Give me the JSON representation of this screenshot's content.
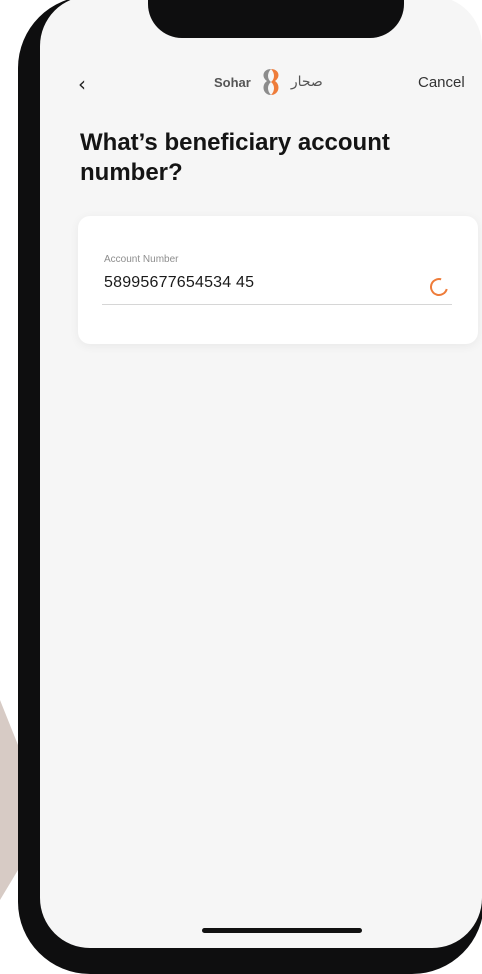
{
  "nav": {
    "back_icon": "‹",
    "logo_latin": "Sohar",
    "logo_arabic": "صحار",
    "cancel_label": "Cancel"
  },
  "page": {
    "title": "What’s beneficiary account number?"
  },
  "account_field": {
    "label": "Account Number",
    "value": "58995677654534 45"
  },
  "colors": {
    "accent": "#ee7c3a",
    "background": "#f6f6f6"
  }
}
